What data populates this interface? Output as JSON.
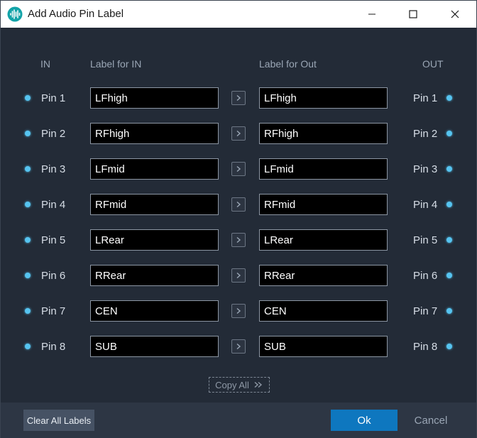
{
  "window": {
    "title": "Add Audio Pin Label",
    "icon": "waveform-icon",
    "controls": [
      "minimize-icon",
      "maximize-icon",
      "close-icon"
    ]
  },
  "headers": {
    "in": "IN",
    "label_in": "Label for IN",
    "label_out": "Label for Out",
    "out": "OUT"
  },
  "rows": [
    {
      "pin_in": "Pin 1",
      "label_in": "LFhigh",
      "label_out": "LFhigh",
      "pin_out": "Pin 1"
    },
    {
      "pin_in": "Pin 2",
      "label_in": "RFhigh",
      "label_out": "RFhigh",
      "pin_out": "Pin 2"
    },
    {
      "pin_in": "Pin 3",
      "label_in": "LFmid",
      "label_out": "LFmid",
      "pin_out": "Pin 3"
    },
    {
      "pin_in": "Pin 4",
      "label_in": "RFmid",
      "label_out": "RFmid",
      "pin_out": "Pin 4"
    },
    {
      "pin_in": "Pin 5",
      "label_in": "LRear",
      "label_out": "LRear",
      "pin_out": "Pin 5"
    },
    {
      "pin_in": "Pin 6",
      "label_in": "RRear",
      "label_out": "RRear",
      "pin_out": "Pin 6"
    },
    {
      "pin_in": "Pin 7",
      "label_in": "CEN",
      "label_out": "CEN",
      "pin_out": "Pin 7"
    },
    {
      "pin_in": "Pin 8",
      "label_in": "SUB",
      "label_out": "SUB",
      "pin_out": "Pin 8"
    }
  ],
  "copy_all_label": "Copy All",
  "footer": {
    "clear_label": "Clear All Labels",
    "ok_label": "Ok",
    "cancel_label": "Cancel"
  },
  "colors": {
    "background": "#232b37",
    "footer": "#2d3644",
    "accent": "#0e77bf",
    "pin_dot": "#56c4f0",
    "field_bg": "#000000"
  }
}
